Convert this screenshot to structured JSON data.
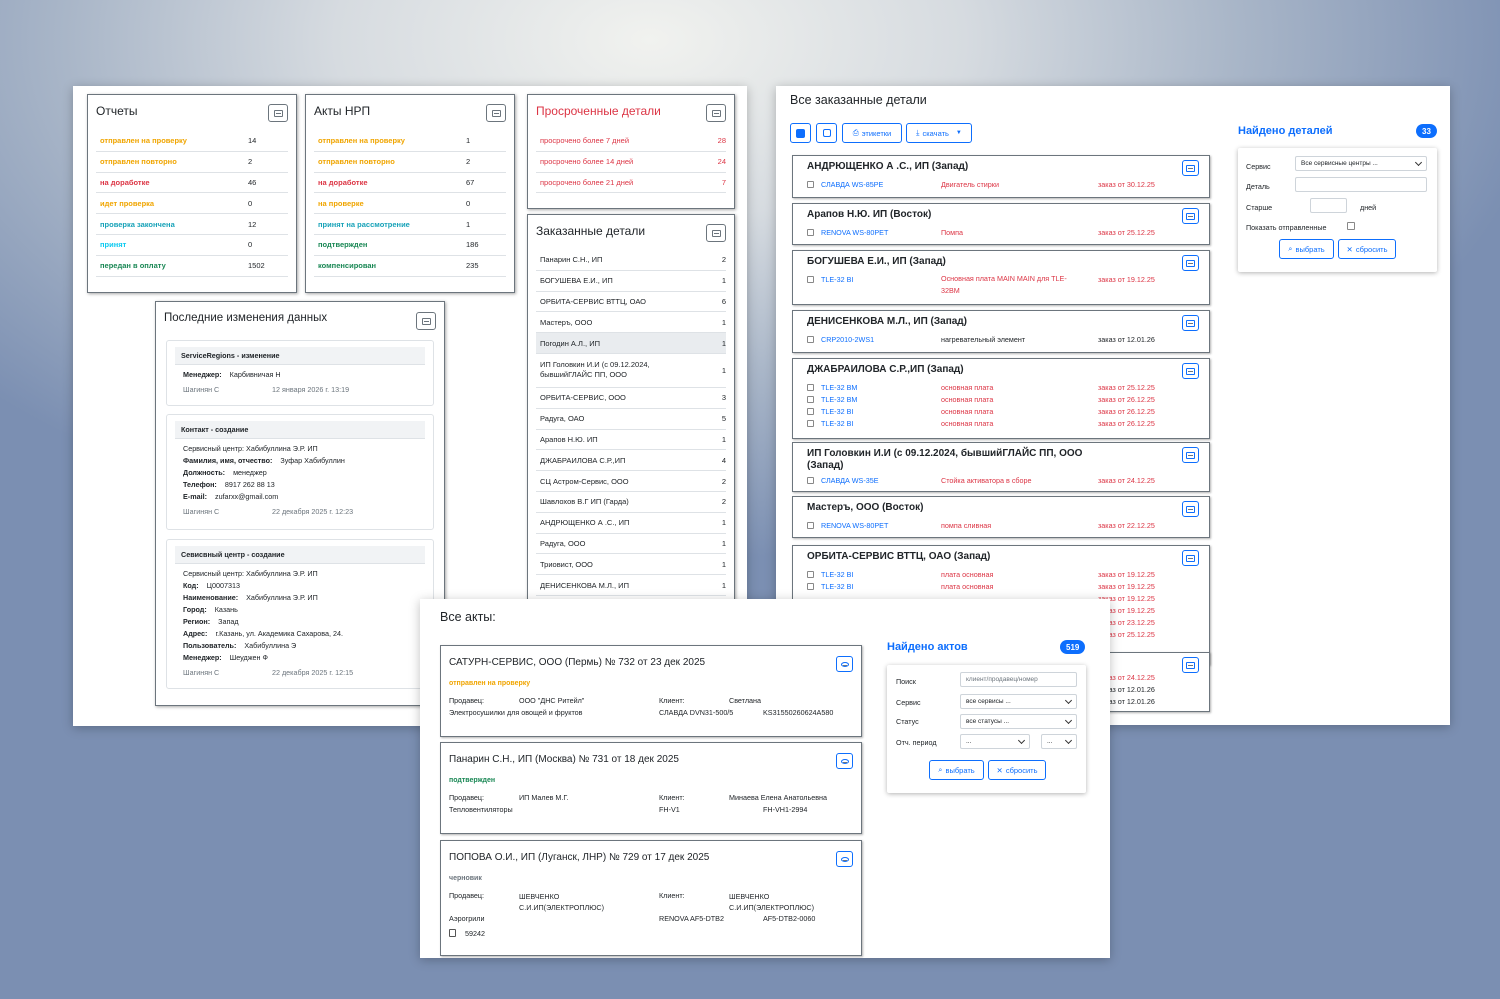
{
  "dashboard": {
    "reports": {
      "title": "Отчеты",
      "rows": [
        {
          "label": "отправлен на проверку",
          "value": "14",
          "color": "#f0a500"
        },
        {
          "label": "отправлен повторно",
          "value": "2",
          "color": "#f0a500"
        },
        {
          "label": "на доработке",
          "value": "46",
          "color": "#dc3545"
        },
        {
          "label": "идет проверка",
          "value": "0",
          "color": "#f0a500"
        },
        {
          "label": "проверка закончена",
          "value": "12",
          "color": "#17a2b8"
        },
        {
          "label": "принят",
          "value": "0",
          "color": "#0dcaf0"
        },
        {
          "label": "передан в оплату",
          "value": "1502",
          "color": "#198754"
        }
      ]
    },
    "acts_nrp": {
      "title": "Акты НРП",
      "rows": [
        {
          "label": "отправлен на проверку",
          "value": "1",
          "color": "#f0a500"
        },
        {
          "label": "отправлен повторно",
          "value": "2",
          "color": "#f0a500"
        },
        {
          "label": "на доработке",
          "value": "67",
          "color": "#dc3545"
        },
        {
          "label": "на проверке",
          "value": "0",
          "color": "#f0a500"
        },
        {
          "label": "принят на рассмотрение",
          "value": "1",
          "color": "#17a2b8"
        },
        {
          "label": "подтвержден",
          "value": "186",
          "color": "#198754"
        },
        {
          "label": "компенсирован",
          "value": "235",
          "color": "#198754"
        }
      ]
    },
    "overdue": {
      "title": "Просроченные детали",
      "rows": [
        {
          "label": "просрочено более 7 дней",
          "value": "28"
        },
        {
          "label": "просрочено более 14 дней",
          "value": "24"
        },
        {
          "label": "просрочено более 21 дней",
          "value": "7"
        }
      ]
    },
    "ordered": {
      "title": "Заказанные детали",
      "rows": [
        {
          "label": "Панарин С.Н., ИП",
          "value": "2"
        },
        {
          "label": "БОГУШЕВА Е.И., ИП",
          "value": "1"
        },
        {
          "label": "ОРБИТА-СЕРВИС ВТТЦ, ОАО",
          "value": "6"
        },
        {
          "label": "Мастеръ, ООО",
          "value": "1"
        },
        {
          "label": "Погодин А.Л., ИП",
          "value": "1"
        },
        {
          "label": "ИП Головкин И.И (с 09.12.2024, бывшийГЛАЙС ПП, ООО",
          "value": "1"
        },
        {
          "label": "ОРБИТА-СЕРВИС, ООО",
          "value": "3"
        },
        {
          "label": "Радуга, ОАО",
          "value": "5"
        },
        {
          "label": "Арапов Н.Ю. ИП",
          "value": "1"
        },
        {
          "label": "ДЖАБРАИЛОВА С.Р.,ИП",
          "value": "4"
        },
        {
          "label": "СЦ Астром-Сервис, ООО",
          "value": "2"
        },
        {
          "label": "Шавлохов В.Г ИП (Гарда)",
          "value": "2"
        },
        {
          "label": "АНДРЮЩЕНКО А .С., ИП",
          "value": "1"
        },
        {
          "label": "Радуга, ООО",
          "value": "1"
        },
        {
          "label": "Триовист, ООО",
          "value": "1"
        },
        {
          "label": "ДЕНИСЕНКОВА М.Л., ИП",
          "value": "1"
        }
      ]
    },
    "changes": {
      "title": "Последние изменения данных",
      "items": [
        {
          "header": "ServiceRegions - изменение",
          "lines": [
            [
              "Менеджер:",
              "Карбивничая Н"
            ]
          ],
          "sub": "",
          "author": "Шагинян С",
          "date": "12 января 2026 г. 13:19"
        },
        {
          "header": "Контакт - создание",
          "sub": "Сервисный центр: Хабибуллина Э.Р. ИП",
          "lines": [
            [
              "Фамилия, имя, отчество:",
              "Зуфар Хабибуллин"
            ],
            [
              "Должность:",
              "менеджер"
            ],
            [
              "Телефон:",
              "8917 262 88 13"
            ],
            [
              "E-mail:",
              "zufarxx@gmail.com"
            ]
          ],
          "author": "Шагинян С",
          "date": "22 декабря 2025 г. 12:23"
        },
        {
          "header": "Севисвный центр - создание",
          "sub": "Сервисный центр: Хабибуллина Э.Р. ИП",
          "lines": [
            [
              "Код:",
              "Ц0007313"
            ],
            [
              "Наименование:",
              "Хабибуллина Э.Р. ИП"
            ],
            [
              "Город:",
              "Казань"
            ],
            [
              "Регион:",
              "Запад"
            ],
            [
              "Адрес:",
              "г.Казань, ул. Академика Сахарова, 24."
            ],
            [
              "Пользователь:",
              "Хабибуллина Э"
            ],
            [
              "Менеджер:",
              "Шеуджен Ф"
            ]
          ],
          "author": "Шагинян С",
          "date": "22 декабря 2025 г. 12:15"
        }
      ]
    }
  },
  "parts": {
    "title": "Все заказанные детали",
    "toolbar": {
      "labels": "этикетки",
      "download": "скачать"
    },
    "groups": [
      {
        "name": "АНДРЮЩЕНКО А .С., ИП (Запад)",
        "items": [
          {
            "product": "СЛАВДА WS-85PE",
            "part": "Двигатель стирки",
            "order": "заказ от 30.12.25",
            "red": true
          }
        ]
      },
      {
        "name": "Арапов Н.Ю. ИП (Восток)",
        "items": [
          {
            "product": "RENOVA WS-80PET",
            "part": "Помпа",
            "order": "заказ от 25.12.25",
            "red": true
          }
        ]
      },
      {
        "name": "БОГУШЕВА Е.И., ИП (Запад)",
        "items": [
          {
            "product": "TLE-32 BI",
            "part": "Основная плата MAIN MAIN для TLE-32BM",
            "order": "заказ от 19.12.25",
            "red": true
          }
        ]
      },
      {
        "name": "ДЕНИСЕНКОВА М.Л., ИП (Запад)",
        "items": [
          {
            "product": "CRP2010-2WS1",
            "part": "нагревательный элемент",
            "order": "заказ от 12.01.26",
            "red": false
          }
        ]
      },
      {
        "name": "ДЖАБРАИЛОВА С.Р.,ИП (Запад)",
        "items": [
          {
            "product": "TLE-32 BM",
            "part": "основная плата",
            "order": "заказ от 25.12.25",
            "red": true
          },
          {
            "product": "TLE-32 BM",
            "part": "основная плата",
            "order": "заказ от 26.12.25",
            "red": true
          },
          {
            "product": "TLE-32 BI",
            "part": "основная плата",
            "order": "заказ от 26.12.25",
            "red": true
          },
          {
            "product": "TLE-32 BI",
            "part": "основная плата",
            "order": "заказ от 26.12.25",
            "red": true
          }
        ]
      },
      {
        "name": "ИП Головкин И.И (с 09.12.2024, бывшийГЛАЙС ПП, ООО (Запад)",
        "items": [
          {
            "product": "СЛАВДА WS-35E",
            "part": "Стойка активатора в сборе",
            "order": "заказ от 24.12.25",
            "red": true
          }
        ]
      },
      {
        "name": "Мастеръ, ООО (Восток)",
        "items": [
          {
            "product": "RENOVA WS-80PET",
            "part": "помпа сливная",
            "order": "заказ от 22.12.25",
            "red": true
          }
        ]
      },
      {
        "name": "ОРБИТА-СЕРВИС ВТТЦ, ОАО (Запад)",
        "items": [
          {
            "product": "TLE-32 BI",
            "part": "плата основная",
            "order": "заказ от 19.12.25",
            "red": true
          },
          {
            "product": "TLE-32 BI",
            "part": "плата основная",
            "order": "заказ от 19.12.25",
            "red": true
          },
          {
            "product": "",
            "part": "",
            "order": "заказ от 19.12.25",
            "red": true
          },
          {
            "product": "",
            "part": "",
            "order": "заказ от 19.12.25",
            "red": true
          },
          {
            "product": "",
            "part": "",
            "order": "заказ от 23.12.25",
            "red": true
          },
          {
            "product": "",
            "part": "",
            "order": "заказ от 25.12.25",
            "red": true
          }
        ]
      },
      {
        "name": "",
        "items": [
          {
            "product": "",
            "part": "",
            "order": "заказ от 24.12.25",
            "red": true
          },
          {
            "product": "",
            "part": "",
            "order": "заказ от 12.01.26",
            "red": false
          },
          {
            "product": "",
            "part": "",
            "order": "заказ от 12.01.26",
            "red": false
          }
        ]
      }
    ],
    "filter": {
      "title": "Найдено деталей",
      "count": "33",
      "service_label": "Сервис",
      "service_value": "Все сервисные центры ...",
      "detail_label": "Деталь",
      "older_label": "Старше",
      "days_label": "дней",
      "show_sent_label": "Показать отправленные",
      "select": "выбрать",
      "reset": "сбросить"
    }
  },
  "acts": {
    "title": "Все акты:",
    "items": [
      {
        "title": "САТУРН-СЕРВИС, ООО (Пермь) № 732 от 23 дек 2025",
        "status": "отправлен на проверку",
        "status_color": "#f0a500",
        "seller_label": "Продавец:",
        "seller": "ООО \"ДНС Ритейл\"",
        "client_label": "Клиент:",
        "client": "Светлана",
        "category": "Электросушилки для овощей и фруктов",
        "model": "СЛАВДА DVN31-500/5",
        "serial": "KS31550260624A580"
      },
      {
        "title": "Панарин С.Н., ИП (Москва) № 731 от 18 дек 2025",
        "status": "подтвержден",
        "status_color": "#198754",
        "seller_label": "Продавец:",
        "seller": "ИП Малев М.Г.",
        "client_label": "Клиент:",
        "client": "Минаева Елена Анатольевна",
        "category": "Тепловентиляторы",
        "model": "FH-V1",
        "serial": "FH-VH1-2994"
      },
      {
        "title": "ПОПОВА О.И., ИП (Луганск, ЛНР) № 729 от 17 дек 2025",
        "status": "черновик",
        "status_color": "#6c757d",
        "seller_label": "Продавец:",
        "seller": "ШЕВЧЕНКО С.И.ИП(ЭЛЕКТРОПЛЮС)",
        "client_label": "Клиент:",
        "client": "ШЕВЧЕНКО С.И.ИП(ЭЛЕКТРОПЛЮС)",
        "category": "Аэрогрили",
        "model": "RENOVA AF5-DTB2",
        "serial": "AF5-DTB2-0060",
        "extra": "59242"
      }
    ],
    "filter": {
      "title": "Найдено актов",
      "count": "519",
      "search_label": "Поиск",
      "search_placeholder": "клиент/продавец/номер",
      "service_label": "Сервис",
      "service_value": "все сервисы ...",
      "status_label": "Статус",
      "status_value": "все статусы ...",
      "period_label": "Отч. период",
      "period_value1": "...",
      "period_value2": "...",
      "select": "выбрать",
      "reset": "сбросить"
    }
  }
}
